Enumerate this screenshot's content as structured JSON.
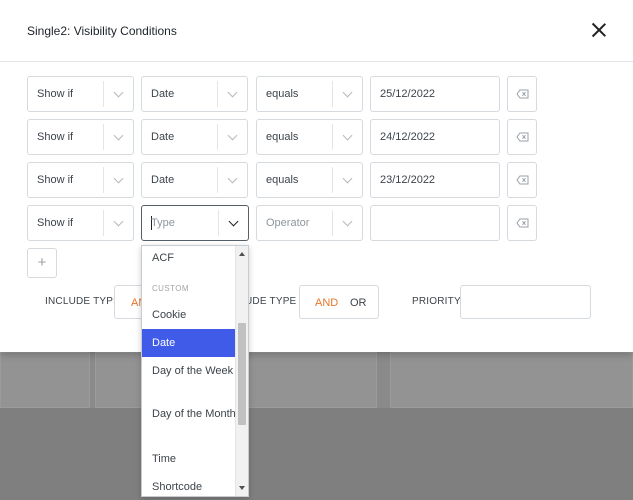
{
  "modal": {
    "title": "Single2: Visibility Conditions"
  },
  "rows": [
    {
      "condition": "Show if",
      "type": "Date",
      "operator": "equals",
      "value": "25/12/2022"
    },
    {
      "condition": "Show if",
      "type": "Date",
      "operator": "equals",
      "value": "24/12/2022"
    },
    {
      "condition": "Show if",
      "type": "Date",
      "operator": "equals",
      "value": "23/12/2022"
    },
    {
      "condition": "Show if",
      "type_placeholder": "Type",
      "operator_placeholder": "Operator",
      "value": ""
    }
  ],
  "add_label": "+",
  "include_type_1": {
    "label": "INCLUDE TYPE",
    "and": "AN"
  },
  "include_type_2": {
    "label": "UDE TYPE",
    "and": "AND",
    "or": "OR"
  },
  "priority": {
    "label": "PRIORITY",
    "value": ""
  },
  "dropdown": {
    "items": [
      {
        "label": "ACF"
      },
      {
        "group": "CUSTOM"
      },
      {
        "label": "Cookie"
      },
      {
        "label": "Date",
        "selected": true
      },
      {
        "label": "Day of the Week"
      },
      {
        "label": "Day of the Month"
      },
      {
        "label": "Time"
      },
      {
        "label": "Shortcode"
      }
    ]
  },
  "icons": {
    "close": "close-icon",
    "delete": "backspace-icon",
    "chevron": "chevron-down-icon",
    "add": "plus-icon"
  },
  "colors": {
    "accent_orange": "#e6752a",
    "selected_blue": "#3f5be8"
  }
}
